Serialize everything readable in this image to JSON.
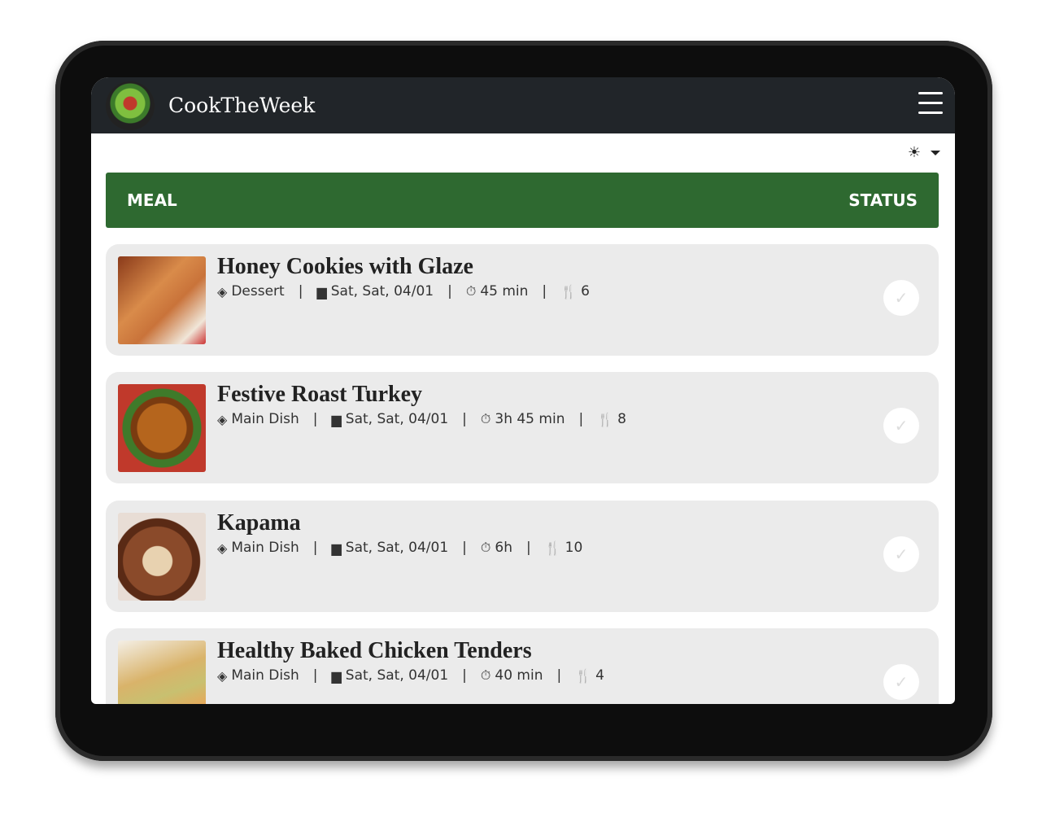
{
  "brand": {
    "name": "CookTheWeek",
    "logo_text": "Cook the Week"
  },
  "theme_toggle": {
    "icon": "sun-icon"
  },
  "table": {
    "col_meal": "MEAL",
    "col_status": "STATUS"
  },
  "colors": {
    "navbar": "#212529",
    "header": "#2e6930",
    "card": "#ebebeb"
  },
  "meals": [
    {
      "title": "Honey Cookies with Glaze",
      "category": "Dessert",
      "date": "Sat, Sat, 04/01",
      "time": "45 min",
      "servings": "6",
      "done": false
    },
    {
      "title": "Festive Roast Turkey",
      "category": "Main Dish",
      "date": "Sat, Sat, 04/01",
      "time": "3h 45 min",
      "servings": "8",
      "done": false
    },
    {
      "title": "Kapama",
      "category": "Main Dish",
      "date": "Sat, Sat, 04/01",
      "time": "6h",
      "servings": "10",
      "done": false
    },
    {
      "title": "Healthy Baked Chicken Tenders",
      "category": "Main Dish",
      "date": "Sat, Sat, 04/01",
      "time": "40 min",
      "servings": "4",
      "done": false
    }
  ]
}
